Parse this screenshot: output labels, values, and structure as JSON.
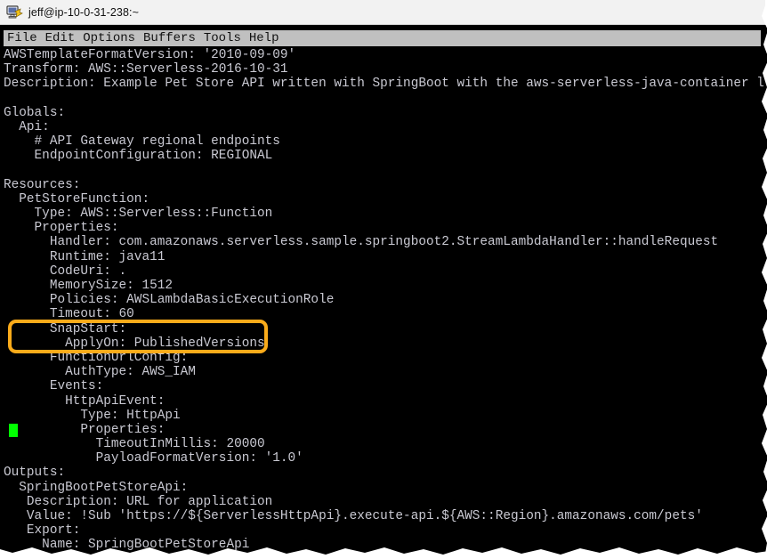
{
  "window": {
    "title": "jeff@ip-10-0-31-238:~",
    "icon": "putty-terminal-icon",
    "background_color": "#000000",
    "text_color": "#c9c9d2"
  },
  "menubar": {
    "items": [
      {
        "label": "File"
      },
      {
        "label": "Edit"
      },
      {
        "label": "Options"
      },
      {
        "label": "Buffers"
      },
      {
        "label": "Tools"
      },
      {
        "label": "Help"
      }
    ],
    "background_color": "#c0c0c0"
  },
  "cursor": {
    "color": "#00ff00",
    "line_index": 26
  },
  "highlight": {
    "color": "#faab1a",
    "target": "SnapStart",
    "lines": [
      "      SnapStart:",
      "        ApplyOn: PublishedVersions"
    ]
  },
  "buffer": {
    "lines": [
      "AWSTemplateFormatVersion: '2010-09-09'",
      "Transform: AWS::Serverless-2016-10-31",
      "Description: Example Pet Store API written with SpringBoot with the aws-serverless-java-container library",
      "",
      "Globals:",
      "  Api:",
      "    # API Gateway regional endpoints",
      "    EndpointConfiguration: REGIONAL",
      "",
      "Resources:",
      "  PetStoreFunction:",
      "    Type: AWS::Serverless::Function",
      "    Properties:",
      "      Handler: com.amazonaws.serverless.sample.springboot2.StreamLambdaHandler::handleRequest",
      "      Runtime: java11",
      "      CodeUri: .",
      "      MemorySize: 1512",
      "      Policies: AWSLambdaBasicExecutionRole",
      "      Timeout: 60",
      "      SnapStart:",
      "        ApplyOn: PublishedVersions",
      "      FunctionUrlConfig:",
      "        AuthType: AWS_IAM",
      "      Events:",
      "        HttpApiEvent:",
      "          Type: HttpApi",
      "          Properties:",
      "            TimeoutInMillis: 20000",
      "            PayloadFormatVersion: '1.0'",
      "Outputs:",
      "  SpringBootPetStoreApi:",
      "   Description: URL for application",
      "   Value: !Sub 'https://${ServerlessHttpApi}.execute-api.${AWS::Region}.amazonaws.com/pets'",
      "   Export:",
      "     Name: SpringBootPetStoreApi"
    ]
  }
}
